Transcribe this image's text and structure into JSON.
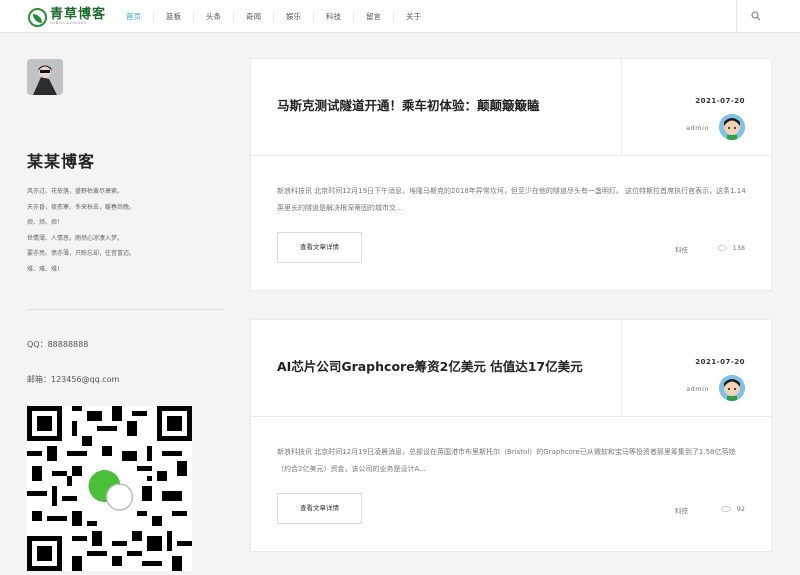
{
  "header": {
    "logo_cn": "青草博客",
    "logo_en": "QINGCAOGOKE",
    "nav": [
      "首页",
      "篮板",
      "头条",
      "奇闻",
      "娱乐",
      "科技",
      "留言",
      "关于"
    ],
    "active_index": 0,
    "search_icon": "search-icon"
  },
  "sidebar": {
    "title": "某某博客",
    "motto": [
      "风亦过、花依落，盛野枯黄尽萧索。",
      "天亦昏，夜愈寒，冬来秋去，暖春尚晚。",
      "烦、烦、烦！",
      "世情薄、人情恶，雨然心凉凄入梦。",
      "要亦亮、债亦薄，只盼忘却，往昔冒迈。",
      "难、难、难！"
    ],
    "qq": "QQ：88888888",
    "email": "邮箱：123456@qq.com"
  },
  "posts": [
    {
      "title": "马斯克测试隧道开通！乘车初体验：颠颠簸簸瞌",
      "date": "2021-07-20",
      "author": "admin",
      "excerpt": "新浪科技讯 北京时间12月19日下午消息，埃隆马斯克的2018年异常坎坷，但至少在他的隧道尽头有一盏明灯。 这位特斯拉首席执行官表示，这条1.14英里长的隧道是解决根深蒂固的城市交...",
      "button": "查看文章详情",
      "tag": "科技",
      "views": "138"
    },
    {
      "title": "AI芯片公司Graphcore筹资2亿美元 估值达17亿美元",
      "date": "2021-07-20",
      "author": "admin",
      "excerpt": "新浪科技讯 北京时间12月19日凌晨消息，总部设在英国港市布里斯托尔（Bristol）的Graphcore已从微软和宝马等投资者那里筹集到了1.58亿英镑（约合2亿美元）资金，该公司的业务是设计A...",
      "button": "查看文章详情",
      "tag": "科技",
      "views": "92"
    }
  ]
}
